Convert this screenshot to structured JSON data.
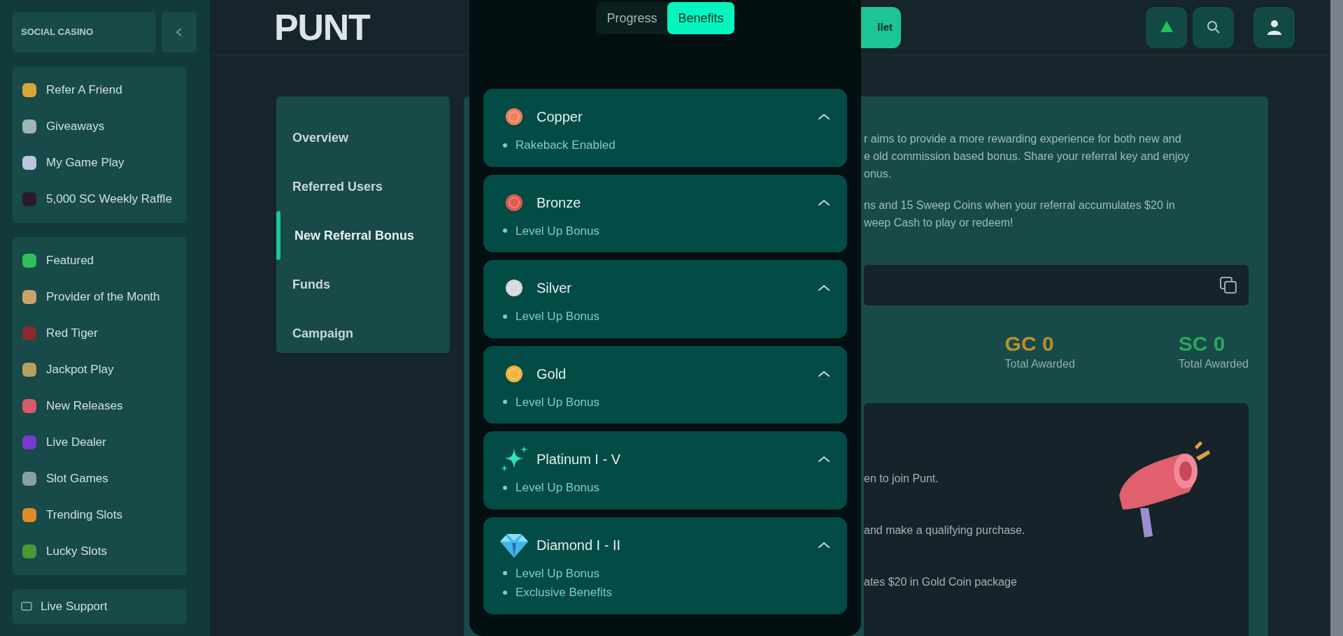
{
  "sidebar": {
    "brand": "SOCIAL CASINO",
    "groups": [
      {
        "items": [
          {
            "label": "Refer A Friend",
            "color": "#d9a53a"
          },
          {
            "label": "Giveaways",
            "color": "#9fb5b3"
          },
          {
            "label": "My Game Play",
            "color": "#b8c8e0"
          },
          {
            "label": "5,000 SC Weekly Raffle",
            "color": "#2a1a2a"
          }
        ]
      },
      {
        "items": [
          {
            "label": "Featured",
            "color": "#2fbf5a"
          },
          {
            "label": "Provider of the Month",
            "color": "#c9a36a"
          },
          {
            "label": "Red Tiger",
            "color": "#8a2a2a"
          },
          {
            "label": "Jackpot Play",
            "color": "#b8a060"
          },
          {
            "label": "New Releases",
            "color": "#d85a6a"
          },
          {
            "label": "Live Dealer",
            "color": "#7a3ad0"
          },
          {
            "label": "Slot Games",
            "color": "#8aa0a8"
          },
          {
            "label": "Trending Slots",
            "color": "#e08a2a"
          },
          {
            "label": "Lucky Slots",
            "color": "#4a9a3a"
          }
        ]
      }
    ],
    "support": "Live Support"
  },
  "header": {
    "logo": "PUNT",
    "wallet_button": "llet"
  },
  "subnav": [
    {
      "label": "Overview",
      "selected": false
    },
    {
      "label": "Referred Users",
      "selected": false
    },
    {
      "label": "New Referral Bonus",
      "selected": true
    },
    {
      "label": "Funds",
      "selected": false
    },
    {
      "label": "Campaign",
      "selected": false
    }
  ],
  "main": {
    "paragraphs": [
      [
        "r aims to provide a more rewarding experience for both new and",
        "e old commission based bonus. Share your referral key and enjoy",
        "onus."
      ],
      [
        "ns and 15 Sweep Coins when your referral accumulates $20 in",
        "weep Cash to play or redeem!"
      ]
    ],
    "stats": [
      {
        "value": "GC 0",
        "label": "Total Awarded",
        "color": "#b8902a"
      },
      {
        "value": "SC 0",
        "label": "Total Awarded",
        "color": "#2aa85a"
      }
    ],
    "steps": [
      "en to join Punt.",
      "and make a qualifying purchase.",
      "ates $20 in Gold Coin package"
    ]
  },
  "modal": {
    "tabs": [
      {
        "label": "Progress",
        "selected": false
      },
      {
        "label": "Benefits",
        "selected": true
      }
    ],
    "tiers": [
      {
        "name": "Copper",
        "kind": "coin",
        "color": "#f07f5e",
        "expanded": true,
        "benefits": [
          "Rakeback Enabled"
        ]
      },
      {
        "name": "Bronze",
        "kind": "coin",
        "color": "#e2584d",
        "expanded": true,
        "benefits": [
          "Level Up Bonus"
        ]
      },
      {
        "name": "Silver",
        "kind": "coin",
        "color": "#d9d6de",
        "expanded": true,
        "benefits": [
          "Level Up Bonus"
        ]
      },
      {
        "name": "Gold",
        "kind": "coin",
        "color": "#f2b33c",
        "expanded": true,
        "benefits": [
          "Level Up Bonus"
        ]
      },
      {
        "name": "Platinum I - V",
        "kind": "sparkle",
        "expanded": true,
        "benefits": [
          "Level Up Bonus"
        ]
      },
      {
        "name": "Diamond I - II",
        "kind": "diamond",
        "expanded": true,
        "benefits": [
          "Level Up Bonus",
          "Exclusive Benefits"
        ]
      }
    ]
  }
}
